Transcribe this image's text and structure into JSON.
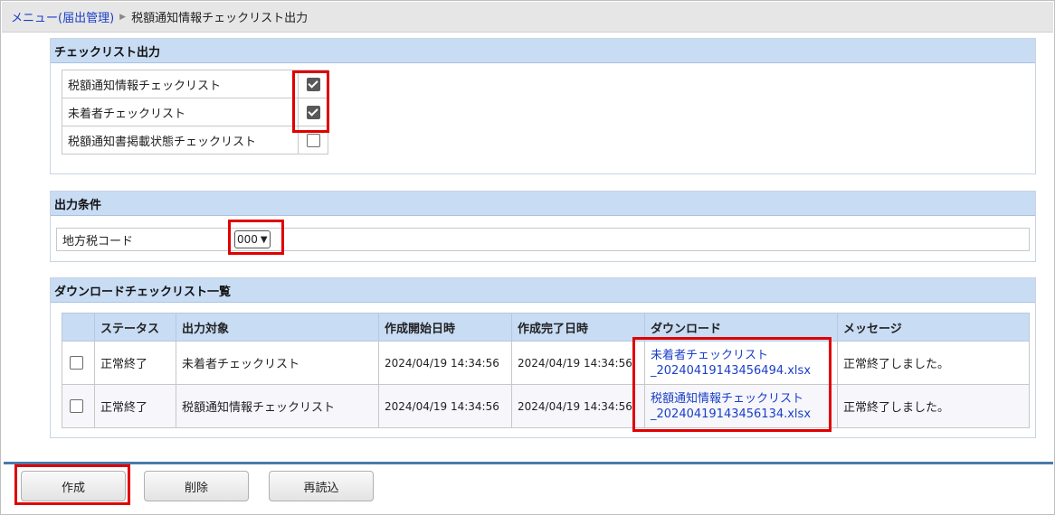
{
  "breadcrumb": {
    "parent": "メニュー(届出管理)",
    "current": "税額通知情報チェックリスト出力"
  },
  "checklist_output": {
    "title": "チェックリスト出力",
    "items": [
      {
        "label": "税額通知情報チェックリスト",
        "checked": true
      },
      {
        "label": "未着者チェックリスト",
        "checked": true
      },
      {
        "label": "税額通知書掲載状態チェックリスト",
        "checked": false
      }
    ]
  },
  "output_conditions": {
    "title": "出力条件",
    "local_tax_code_label": "地方税コード",
    "local_tax_code_value": "000"
  },
  "download_list": {
    "title": "ダウンロードチェックリスト一覧",
    "columns": [
      "",
      "ステータス",
      "出力対象",
      "作成開始日時",
      "作成完了日時",
      "ダウンロード",
      "メッセージ"
    ],
    "rows": [
      {
        "status": "正常終了",
        "target": "未着者チェックリスト",
        "start": "2024/04/19 14:34:56",
        "end": "2024/04/19 14:34:56",
        "download_line1": "未着者チェックリスト",
        "download_line2": "_20240419143456494.xlsx",
        "message": "正常終了しました。"
      },
      {
        "status": "正常終了",
        "target": "税額通知情報チェックリスト",
        "start": "2024/04/19 14:34:56",
        "end": "2024/04/19 14:34:56",
        "download_line1": "税額通知情報チェックリスト",
        "download_line2": "_20240419143456134.xlsx",
        "message": "正常終了しました。"
      }
    ]
  },
  "buttons": {
    "create": "作成",
    "delete": "削除",
    "reload": "再読込"
  },
  "colors": {
    "highlight": "#e00000",
    "header_bg": "#c8dcf4",
    "link": "#1a3fc7",
    "divider": "#4a7aa8"
  }
}
